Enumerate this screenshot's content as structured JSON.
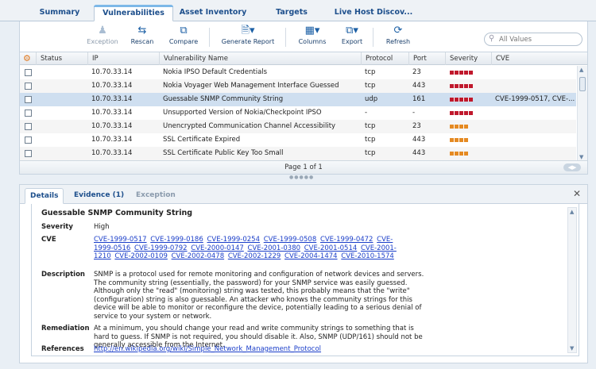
{
  "tabs": [
    {
      "label": "Summary"
    },
    {
      "label": "Vulnerabilities"
    },
    {
      "label": "Asset Inventory"
    },
    {
      "label": "Targets"
    },
    {
      "label": "Live Host Discov..."
    }
  ],
  "toolbar": {
    "exception": "Exception",
    "rescan": "Rescan",
    "compare": "Compare",
    "generate_report": "Generate Report",
    "columns": "Columns",
    "export": "Export",
    "refresh": "Refresh",
    "search_placeholder": "All Values"
  },
  "grid": {
    "headers": {
      "status": "Status",
      "ip": "IP",
      "name": "Vulnerability Name",
      "protocol": "Protocol",
      "port": "Port",
      "severity": "Severity",
      "cve": "CVE"
    },
    "rows": [
      {
        "ip": "10.70.33.14",
        "name": "Nokia IPSO Default Credentials",
        "protocol": "tcp",
        "port": "23",
        "severity": "high",
        "cve": ""
      },
      {
        "ip": "10.70.33.14",
        "name": "Nokia Voyager Web Management Interface Guessed",
        "protocol": "tcp",
        "port": "443",
        "severity": "high",
        "cve": ""
      },
      {
        "ip": "10.70.33.14",
        "name": "Guessable SNMP Community String",
        "protocol": "udp",
        "port": "161",
        "severity": "high",
        "cve": "CVE-1999-0517, CVE-..."
      },
      {
        "ip": "10.70.33.14",
        "name": "Unsupported Version of Nokia/Checkpoint IPSO",
        "protocol": "-",
        "port": "-",
        "severity": "high",
        "cve": ""
      },
      {
        "ip": "10.70.33.14",
        "name": "Unencrypted Communication Channel Accessibility",
        "protocol": "tcp",
        "port": "23",
        "severity": "medium",
        "cve": ""
      },
      {
        "ip": "10.70.33.14",
        "name": "SSL Certificate Expired",
        "protocol": "tcp",
        "port": "443",
        "severity": "medium",
        "cve": ""
      },
      {
        "ip": "10.70.33.14",
        "name": "SSL Certificate Public Key Too Small",
        "protocol": "tcp",
        "port": "443",
        "severity": "medium",
        "cve": ""
      }
    ],
    "pager": "Page 1 of 1"
  },
  "details": {
    "tabs": {
      "details": "Details",
      "evidence": "Evidence (1)",
      "exception": "Exception"
    },
    "title": "Guessable SNMP Community String",
    "labels": {
      "severity": "Severity",
      "cve": "CVE",
      "description": "Description",
      "remediation": "Remediation",
      "references": "References"
    },
    "severity": "High",
    "cves": [
      "CVE-1999-0517",
      "CVE-1999-0186",
      "CVE-1999-0254",
      "CVE-1999-0508",
      "CVE-1999-0472",
      "CVE-1999-0516",
      "CVE-1999-0792",
      "CVE-2000-0147",
      "CVE-2001-0380",
      "CVE-2001-0514",
      "CVE-2001-1210",
      "CVE-2002-0109",
      "CVE-2002-0478",
      "CVE-2002-1229",
      "CVE-2004-1474",
      "CVE-2010-1574"
    ],
    "description": "SNMP is a protocol used for remote monitoring and configuration of network devices and servers. The community string (essentially, the password) for your SNMP service was easily guessed. Although only the \"read\" (monitoring) string was tested, this probably means that the \"write\" (configuration) string is also guessable. An attacker who knows the community strings for this device will be able to monitor or reconfigure the device, potentially leading to a serious denial of service to your system or network.",
    "remediation": "At a minimum, you should change your read and write community strings to something that is hard to guess. If SNMP is not required, you should disable it. Also, SNMP (UDP/161) should not be generally accessible from the Internet.",
    "reference": "http://en.wikipedia.org/wiki/Simple_Network_Management_Protocol"
  }
}
